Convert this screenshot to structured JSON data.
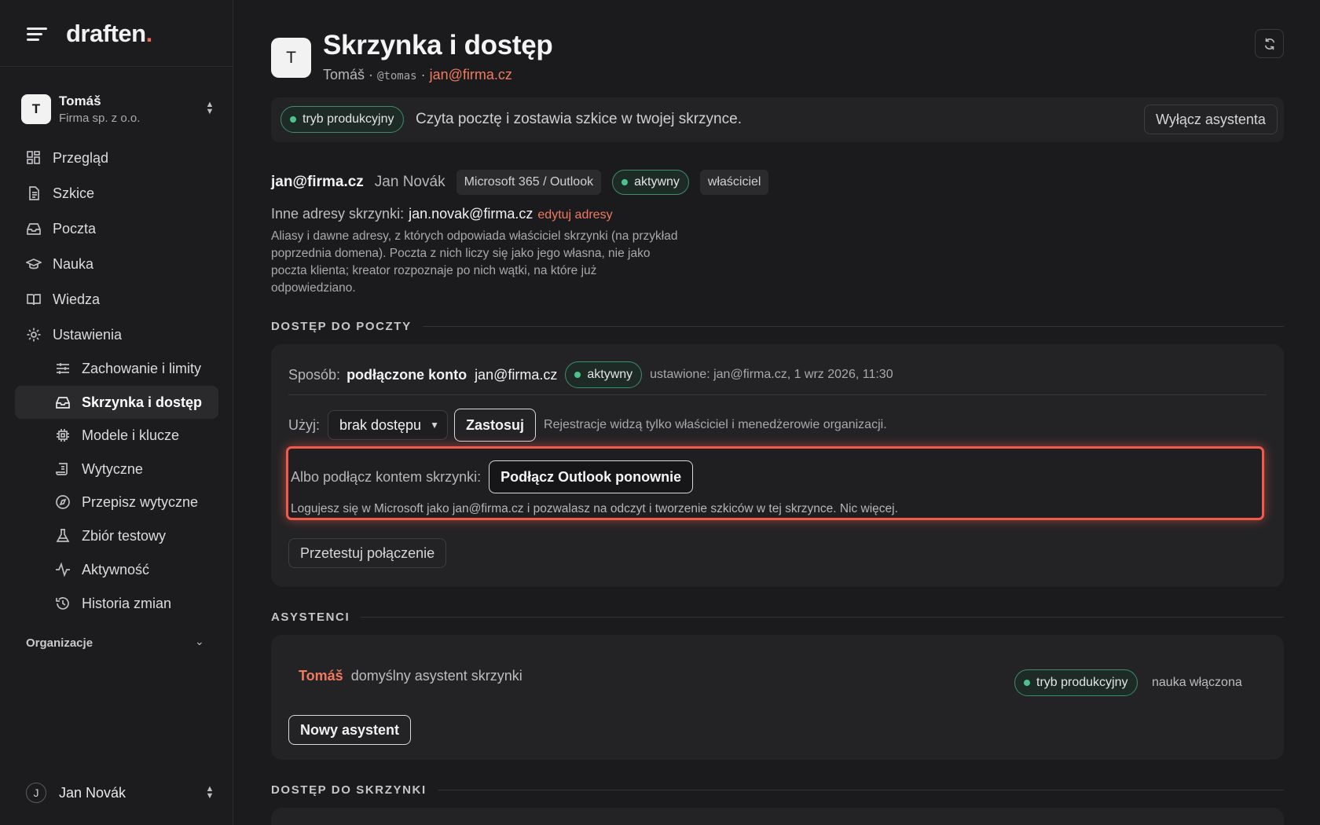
{
  "brand": {
    "name": "draften",
    "dot": "."
  },
  "workspace": {
    "avatar": "T",
    "name": "Tomáš",
    "company": "Firma sp. z o.o."
  },
  "nav": {
    "items": [
      {
        "label": "Przegląd",
        "icon": "dashboard-icon"
      },
      {
        "label": "Szkice",
        "icon": "document-icon"
      },
      {
        "label": "Poczta",
        "icon": "inbox-icon"
      },
      {
        "label": "Nauka",
        "icon": "graduation-cap-icon"
      },
      {
        "label": "Wiedza",
        "icon": "book-icon"
      },
      {
        "label": "Ustawienia",
        "icon": "gear-icon"
      }
    ],
    "sub_items": [
      {
        "label": "Zachowanie i limity",
        "icon": "sliders-icon"
      },
      {
        "label": "Skrzynka i dostęp",
        "icon": "inbox-icon",
        "active": true
      },
      {
        "label": "Modele i klucze",
        "icon": "chip-icon"
      },
      {
        "label": "Wytyczne",
        "icon": "scroll-icon"
      },
      {
        "label": "Przepisz wytyczne",
        "icon": "compass-icon"
      },
      {
        "label": "Zbiór testowy",
        "icon": "flask-icon"
      },
      {
        "label": "Aktywność",
        "icon": "activity-icon"
      },
      {
        "label": "Historia zmian",
        "icon": "history-icon"
      }
    ],
    "org_label": "Organizacje"
  },
  "user": {
    "avatar": "J",
    "name": "Jan Novák"
  },
  "header": {
    "avatar": "T",
    "title": "Skrzynka i dostęp",
    "name": "Tomáš",
    "sep1": " · ",
    "handle": "@tomas",
    "sep2": " · ",
    "email": "jan@firma.cz"
  },
  "banner": {
    "mode": "tryb produkcyjny",
    "message": "Czyta pocztę i zostawia szkice w twojej skrzynce.",
    "button": "Wyłącz asystenta"
  },
  "account": {
    "email": "jan@firma.cz",
    "name": "Jan Novák",
    "provider": "Microsoft 365 / Outlook",
    "status": "aktywny",
    "role": "właściciel",
    "other_label": "Inne adresy skrzynki:",
    "other_value": "jan.novak@firma.cz",
    "edit_link": "edytuj adresy",
    "note": "Aliasy i dawne adresy, z których odpowiada właściciel skrzynki (na przykład poprzednia domena). Poczta z nich liczy się jako jego własna, nie jako poczta klienta; kreator rozpoznaje po nich wątki, na które już odpowiedziano."
  },
  "mail_access": {
    "heading": "DOSTĘP DO POCZTY",
    "method_label": "Sposób:",
    "method_value": "podłączone konto",
    "method_email": "jan@firma.cz",
    "status": "aktywny",
    "set_info": "ustawione: jan@firma.cz, 1 wrz 2026, 11:30",
    "use_label": "Użyj:",
    "use_value": "brak dostępu",
    "apply": "Zastosuj",
    "apply_hint": "Rejestracje widzą tylko właściciel i menedżerowie organizacji.",
    "connect_label": "Albo podłącz kontem skrzynki:",
    "connect_button": "Podłącz Outlook ponownie",
    "connect_note": "Logujesz się w Microsoft jako jan@firma.cz i pozwalasz na odczyt i tworzenie szkiców w tej skrzynce. Nic więcej.",
    "test_button": "Przetestuj połączenie"
  },
  "assistants": {
    "heading": "ASYSTENCI",
    "name": "Tomáš",
    "description": "domyślny asystent skrzynki",
    "mode": "tryb produkcyjny",
    "learning": "nauka włączona",
    "new_button": "Nowy asystent"
  },
  "mailbox_access": {
    "heading": "DOSTĘP DO SKRZYNKI"
  },
  "colors": {
    "accent": "#ef7a60",
    "status_green": "#4cc38a",
    "highlight": "#f25b4b"
  }
}
